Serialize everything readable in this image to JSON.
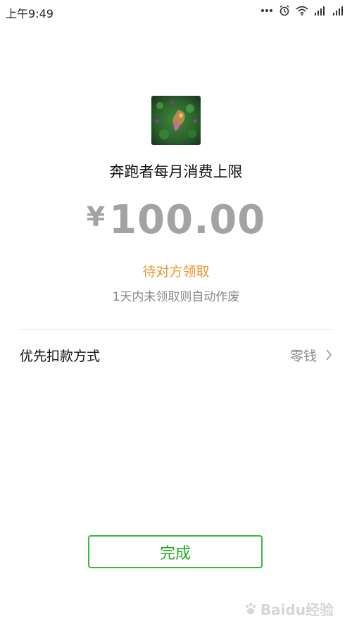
{
  "status_bar": {
    "time": "上午9:49",
    "icons": [
      "more-dots-icon",
      "alarm-icon",
      "wifi-icon",
      "signal-icon",
      "signal-icon"
    ]
  },
  "payee": {
    "avatar_icon": "avatar-image",
    "name": "奔跑者每月消费上限"
  },
  "amount": {
    "currency": "¥",
    "value": "100.00"
  },
  "transfer_status": "待对方领取",
  "expiry_note": "1天内未领取则自动作废",
  "payment_method": {
    "label": "优先扣款方式",
    "value": "零钱"
  },
  "done_button": {
    "label": "完成"
  },
  "colors": {
    "pending": "#f0952f",
    "button_green": "#38b838",
    "amount_gray": "#a3a3a3"
  },
  "watermark": {
    "text": "Baidu经验"
  }
}
